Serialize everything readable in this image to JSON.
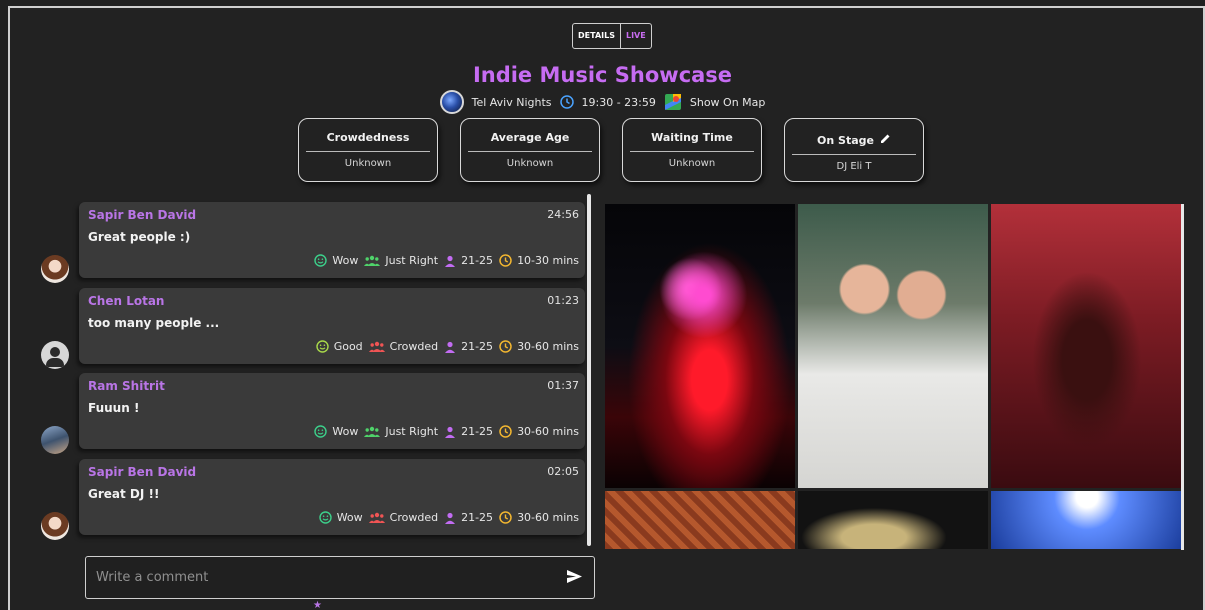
{
  "toggle": {
    "details": "DETAILS",
    "live": "LIVE"
  },
  "event": {
    "title": "Indie Music Showcase",
    "venue": "Tel Aviv Nights",
    "hours": "19:30 - 23:59",
    "map_link": "Show On Map"
  },
  "stats": [
    {
      "label": "Crowdedness",
      "value": "Unknown"
    },
    {
      "label": "Average Age",
      "value": "Unknown"
    },
    {
      "label": "Waiting Time",
      "value": "Unknown"
    },
    {
      "label": "On Stage",
      "value": "DJ Eli T"
    }
  ],
  "messages": [
    {
      "name": "Sapir Ben David",
      "time": "24:56",
      "text": "Great people :)",
      "vibe": "Wow",
      "crowd": "Just Right",
      "crowd_color": "#4fd36a",
      "age": "21-25",
      "wait": "10-30 mins"
    },
    {
      "name": "Chen Lotan",
      "time": "01:23",
      "text": "too many people ...",
      "vibe": "Good",
      "crowd": "Crowded",
      "crowd_color": "#f05454",
      "age": "21-25",
      "wait": "30-60 mins"
    },
    {
      "name": "Ram Shitrit",
      "time": "01:37",
      "text": "Fuuun !",
      "vibe": "Wow",
      "crowd": "Just Right",
      "crowd_color": "#4fd36a",
      "age": "21-25",
      "wait": "30-60 mins"
    },
    {
      "name": "Sapir Ben David",
      "time": "02:05",
      "text": "Great DJ !!",
      "vibe": "Wow",
      "crowd": "Crowded",
      "crowd_color": "#f05454",
      "age": "21-25",
      "wait": "30-60 mins"
    }
  ],
  "comment": {
    "placeholder": "Write a comment"
  },
  "colors": {
    "accent": "#c66cf2",
    "vibe": "#3ccf8a",
    "age": "#c26cf2",
    "wait": "#f2b630"
  }
}
